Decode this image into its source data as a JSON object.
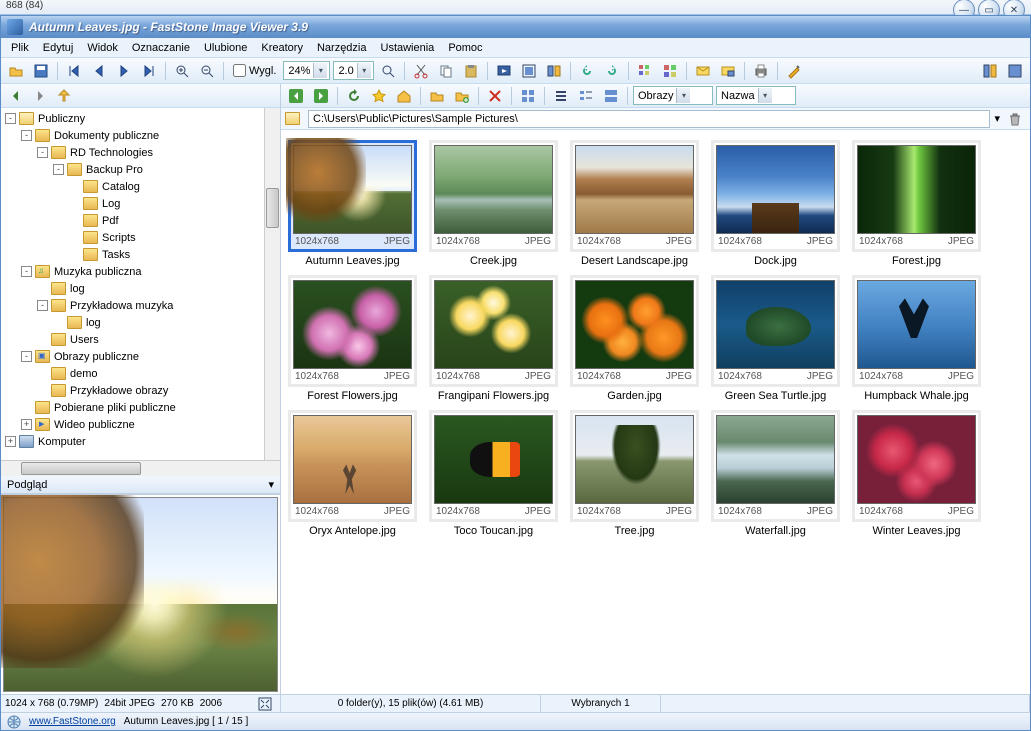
{
  "outer_label": "868 (84)",
  "title": "Autumn Leaves.jpg  -  FastStone Image Viewer 3.9",
  "menu": [
    "Plik",
    "Edytuj",
    "Widok",
    "Oznaczanie",
    "Ulubione",
    "Kreatory",
    "Narzędzia",
    "Ustawienia",
    "Pomoc"
  ],
  "toolbar1": {
    "view_checkbox": "Wygl.",
    "zoom1": "24%",
    "zoom2": "2.0"
  },
  "browser_toolbar": {
    "filter": "Obrazy",
    "sort": "Nazwa"
  },
  "address": "C:\\Users\\Public\\Pictures\\Sample Pictures\\",
  "tree": [
    {
      "d": 0,
      "e": "-",
      "t": "Publiczny",
      "ic": "folder open"
    },
    {
      "d": 1,
      "e": "-",
      "t": "Dokumenty publiczne",
      "ic": "folder"
    },
    {
      "d": 2,
      "e": "-",
      "t": "RD Technologies",
      "ic": "folder"
    },
    {
      "d": 3,
      "e": "-",
      "t": "Backup Pro",
      "ic": "folder"
    },
    {
      "d": 4,
      "e": "",
      "t": "Catalog",
      "ic": "folder"
    },
    {
      "d": 4,
      "e": "",
      "t": "Log",
      "ic": "folder"
    },
    {
      "d": 4,
      "e": "",
      "t": "Pdf",
      "ic": "folder"
    },
    {
      "d": 4,
      "e": "",
      "t": "Scripts",
      "ic": "folder"
    },
    {
      "d": 4,
      "e": "",
      "t": "Tasks",
      "ic": "folder"
    },
    {
      "d": 1,
      "e": "-",
      "t": "Muzyka publiczna",
      "ic": "folder music"
    },
    {
      "d": 2,
      "e": "",
      "t": "log",
      "ic": "folder"
    },
    {
      "d": 2,
      "e": "-",
      "t": "Przykładowa muzyka",
      "ic": "folder"
    },
    {
      "d": 3,
      "e": "",
      "t": "log",
      "ic": "folder"
    },
    {
      "d": 2,
      "e": "",
      "t": "Users",
      "ic": "folder"
    },
    {
      "d": 1,
      "e": "-",
      "t": "Obrazy publiczne",
      "ic": "folder image"
    },
    {
      "d": 2,
      "e": "",
      "t": "demo",
      "ic": "folder"
    },
    {
      "d": 2,
      "e": "",
      "t": "Przykładowe obrazy",
      "ic": "folder"
    },
    {
      "d": 1,
      "e": "",
      "t": "Pobierane pliki publiczne",
      "ic": "folder"
    },
    {
      "d": 1,
      "e": "+",
      "t": "Wideo publiczne",
      "ic": "folder video"
    },
    {
      "d": 0,
      "e": "+",
      "t": "Komputer",
      "ic": "computer"
    }
  ],
  "preview_label": "Podgląd",
  "info_bar": {
    "dims": "1024 x 768 (0.79MP)",
    "bits": "24bit JPEG",
    "size": "270 KB",
    "year": "2006"
  },
  "thumbs": [
    {
      "name": "Autumn Leaves.jpg",
      "dims": "1024x768",
      "fmt": "JPEG",
      "cls": "sc-autumn",
      "sel": true
    },
    {
      "name": "Creek.jpg",
      "dims": "1024x768",
      "fmt": "JPEG",
      "cls": "sc-creek"
    },
    {
      "name": "Desert Landscape.jpg",
      "dims": "1024x768",
      "fmt": "JPEG",
      "cls": "sc-desert"
    },
    {
      "name": "Dock.jpg",
      "dims": "1024x768",
      "fmt": "JPEG",
      "cls": "sc-dock"
    },
    {
      "name": "Forest.jpg",
      "dims": "1024x768",
      "fmt": "JPEG",
      "cls": "sc-forest"
    },
    {
      "name": "Forest Flowers.jpg",
      "dims": "1024x768",
      "fmt": "JPEG",
      "cls": "sc-fflowers"
    },
    {
      "name": "Frangipani Flowers.jpg",
      "dims": "1024x768",
      "fmt": "JPEG",
      "cls": "sc-frangipani"
    },
    {
      "name": "Garden.jpg",
      "dims": "1024x768",
      "fmt": "JPEG",
      "cls": "sc-garden"
    },
    {
      "name": "Green Sea Turtle.jpg",
      "dims": "1024x768",
      "fmt": "JPEG",
      "cls": "sc-turtle"
    },
    {
      "name": "Humpback Whale.jpg",
      "dims": "1024x768",
      "fmt": "JPEG",
      "cls": "sc-whale"
    },
    {
      "name": "Oryx Antelope.jpg",
      "dims": "1024x768",
      "fmt": "JPEG",
      "cls": "sc-oryx"
    },
    {
      "name": "Toco Toucan.jpg",
      "dims": "1024x768",
      "fmt": "JPEG",
      "cls": "sc-toucan"
    },
    {
      "name": "Tree.jpg",
      "dims": "1024x768",
      "fmt": "JPEG",
      "cls": "sc-tree"
    },
    {
      "name": "Waterfall.jpg",
      "dims": "1024x768",
      "fmt": "JPEG",
      "cls": "sc-waterfall"
    },
    {
      "name": "Winter Leaves.jpg",
      "dims": "1024x768",
      "fmt": "JPEG",
      "cls": "sc-winter"
    }
  ],
  "status": {
    "folders": "0 folder(y), 15 plik(ów) (4.61 MB)",
    "selected": "Wybranych 1"
  },
  "footer": {
    "site": "www.FastStone.org",
    "current": "Autumn Leaves.jpg [ 1 / 15 ]"
  }
}
